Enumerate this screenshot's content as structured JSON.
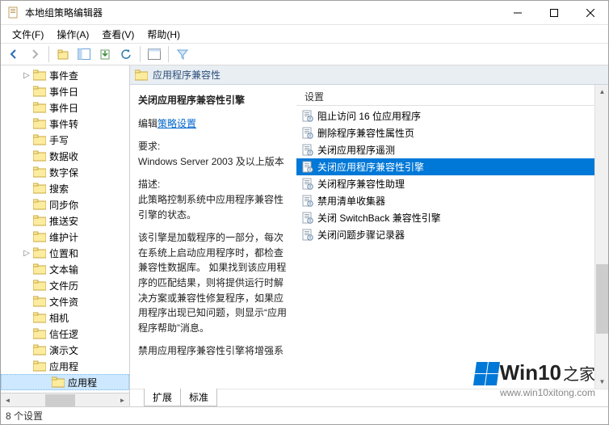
{
  "title": "本地组策略编辑器",
  "menu": {
    "file": "文件(F)",
    "action": "操作(A)",
    "view": "查看(V)",
    "help": "帮助(H)"
  },
  "tree": {
    "items": [
      {
        "label": "事件查",
        "expandable": true
      },
      {
        "label": "事件日",
        "expandable": false
      },
      {
        "label": "事件日",
        "expandable": false
      },
      {
        "label": "事件转",
        "expandable": false
      },
      {
        "label": "手写",
        "expandable": false
      },
      {
        "label": "数据收",
        "expandable": false
      },
      {
        "label": "数字保",
        "expandable": false
      },
      {
        "label": "搜索",
        "expandable": false
      },
      {
        "label": "同步你",
        "expandable": false
      },
      {
        "label": "推送安",
        "expandable": false
      },
      {
        "label": "维护计",
        "expandable": false
      },
      {
        "label": "位置和",
        "expandable": true
      },
      {
        "label": "文本输",
        "expandable": false
      },
      {
        "label": "文件历",
        "expandable": false
      },
      {
        "label": "文件资",
        "expandable": false
      },
      {
        "label": "相机",
        "expandable": false
      },
      {
        "label": "信任逻",
        "expandable": false
      },
      {
        "label": "演示文",
        "expandable": false
      },
      {
        "label": "应用程",
        "expandable": false
      },
      {
        "label": "应用程",
        "selected": true,
        "child": true
      }
    ]
  },
  "right": {
    "header": "应用程序兼容性",
    "desc": {
      "title": "关闭应用程序兼容性引擎",
      "edit_prefix": "编辑",
      "edit_link": "策略设置",
      "req_label": "要求:",
      "req_text": "Windows Server 2003 及以上版本",
      "desc_label": "描述:",
      "desc_p1": "   此策略控制系统中应用程序兼容性引擎的状态。",
      "desc_p2": "该引擎是加载程序的一部分，每次在系统上启动应用程序时，都检查兼容性数据库。 如果找到该应用程序的匹配结果，则将提供运行时解决方案或兼容性修复程序，如果应用程序出现已知问题，则显示“应用程序帮助”消息。",
      "desc_p3": "禁用应用程序兼容性引擎将增强系"
    },
    "settings_header": "设置",
    "settings": [
      {
        "label": "阻止访问 16 位应用程序"
      },
      {
        "label": "删除程序兼容性属性页"
      },
      {
        "label": "关闭应用程序遥测"
      },
      {
        "label": "关闭应用程序兼容性引擎",
        "selected": true
      },
      {
        "label": "关闭程序兼容性助理"
      },
      {
        "label": "禁用清单收集器"
      },
      {
        "label": "关闭 SwitchBack 兼容性引擎"
      },
      {
        "label": "关闭问题步骤记录器"
      }
    ]
  },
  "tabs": {
    "extended": "扩展",
    "standard": "标准"
  },
  "status": "8 个设置",
  "watermark": {
    "brand": "Win10",
    "suffix": "之家",
    "url": "www.win10xitong.com"
  }
}
